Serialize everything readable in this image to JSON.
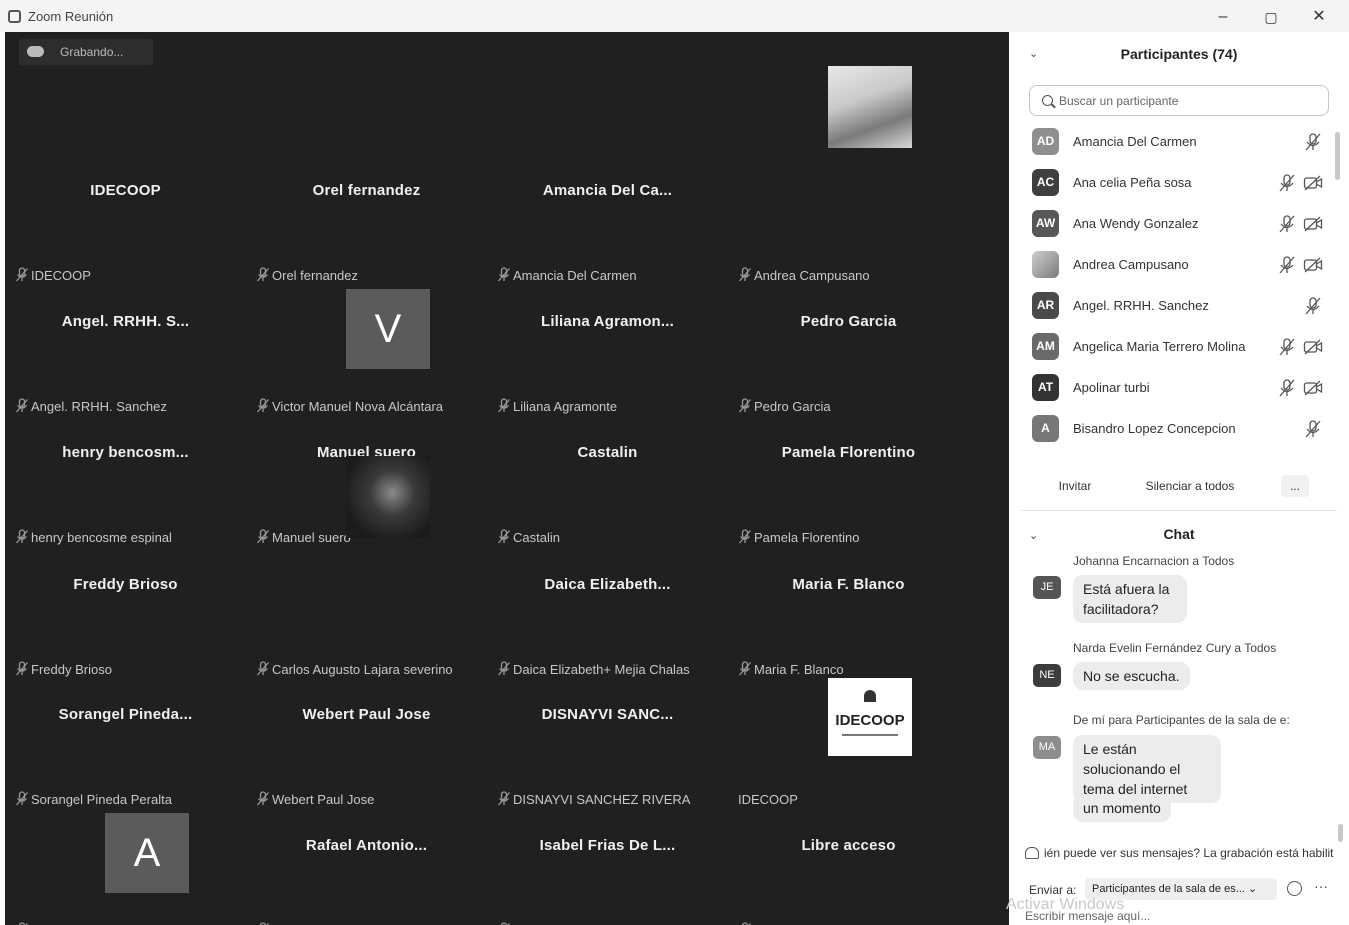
{
  "window": {
    "title": "Zoom Reunión",
    "minimize": "–",
    "restore": "▢",
    "close": "✕"
  },
  "recording": {
    "label": "Grabando..."
  },
  "tiles": [
    {
      "name": "IDECOOP",
      "label": "IDECOOP"
    },
    {
      "name": "Orel fernandez",
      "label": "Orel fernandez"
    },
    {
      "name": "Amancia Del Ca...",
      "label": "Amancia Del Carmen"
    },
    {
      "name": "",
      "label": "Andrea Campusano"
    },
    {
      "name": "Angel. RRHH. S...",
      "label": "Angel. RRHH. Sanchez"
    },
    {
      "name": "",
      "label": "Victor Manuel Nova Alcántara",
      "avatar": "V"
    },
    {
      "name": "Liliana Agramon...",
      "label": "Liliana Agramonte"
    },
    {
      "name": "Pedro Garcia",
      "label": "Pedro Garcia"
    },
    {
      "name": "henry bencosm...",
      "label": "henry bencosme espinal"
    },
    {
      "name": "Manuel suero",
      "label": "Manuel suero"
    },
    {
      "name": "Castalin",
      "label": "Castalin"
    },
    {
      "name": "Pamela Florentino",
      "label": "Pamela Florentino"
    },
    {
      "name": "Freddy Brioso",
      "label": "Freddy Brioso"
    },
    {
      "name": "",
      "label": "Carlos Augusto Lajara severino"
    },
    {
      "name": "Daica Elizabeth...",
      "label": "Daica Elizabeth+ Mejia Chalas"
    },
    {
      "name": "Maria F. Blanco",
      "label": "Maria F. Blanco"
    },
    {
      "name": "Sorangel Pineda...",
      "label": "Sorangel Pineda Peralta"
    },
    {
      "name": "Webert Paul Jose",
      "label": "Webert Paul Jose"
    },
    {
      "name": "DISNAYVI SANC...",
      "label": "DISNAYVI SANCHEZ RIVERA"
    },
    {
      "name": "",
      "label": "IDECOOP",
      "logo": "IDECOOP"
    },
    {
      "name": "",
      "label": "Bisandro Lopez Concepcion",
      "avatar": "A"
    },
    {
      "name": "Rafael Antonio...",
      "label": "Rafael Antonio Coca Rosso"
    },
    {
      "name": "Isabel Frias De L...",
      "label": "Isabel Frias De Los Santos"
    },
    {
      "name": "Libre acceso",
      "label": "Libre acceso"
    }
  ],
  "participants": {
    "title": "Participantes (74)",
    "search_placeholder": "Buscar un participante",
    "items": [
      {
        "initials": "AD",
        "name": "Amancia Del Carmen",
        "color": "#8f8f8f"
      },
      {
        "initials": "AC",
        "name": "Ana celia Peña sosa",
        "color": "#3f3f3f"
      },
      {
        "initials": "AW",
        "name": "Ana Wendy Gonzalez",
        "color": "#575757"
      },
      {
        "initials": "",
        "name": "Andrea Campusano",
        "color": "#9a9a9a"
      },
      {
        "initials": "AR",
        "name": "Angel. RRHH. Sanchez",
        "color": "#4a4a4a"
      },
      {
        "initials": "AM",
        "name": "Angelica Maria Terrero Molina",
        "color": "#6a6a6a"
      },
      {
        "initials": "AT",
        "name": "Apolinar turbi",
        "color": "#333333"
      },
      {
        "initials": "A",
        "name": "Bisandro Lopez Concepcion",
        "color": "#777777"
      }
    ],
    "buttons": {
      "invite": "Invitar",
      "mute_all": "Silenciar a todos",
      "more": "..."
    }
  },
  "chat": {
    "title": "Chat",
    "messages": [
      {
        "initials": "JE",
        "sender": "Johanna Encarnacion a Todos",
        "texts": [
          "Está afuera la facilitadora?"
        ]
      },
      {
        "initials": "NE",
        "sender": "Narda Evelin Fernández Cury a Todos",
        "texts": [
          "No se escucha."
        ]
      },
      {
        "initials": "MA",
        "sender": "De mí para Participantes de la sala de e:",
        "texts": [
          "Le están solucionando el tema del internet",
          "un momento"
        ]
      }
    ],
    "notice": "ién puede ver sus mensajes? La grabación está habilit",
    "send_to_label": "Enviar a:",
    "send_to_value": "Participantes de la sala de es... ⌄",
    "input_placeholder": "Escribir mensaje aquí...",
    "more": "···"
  },
  "watermark": "Activar Windows"
}
